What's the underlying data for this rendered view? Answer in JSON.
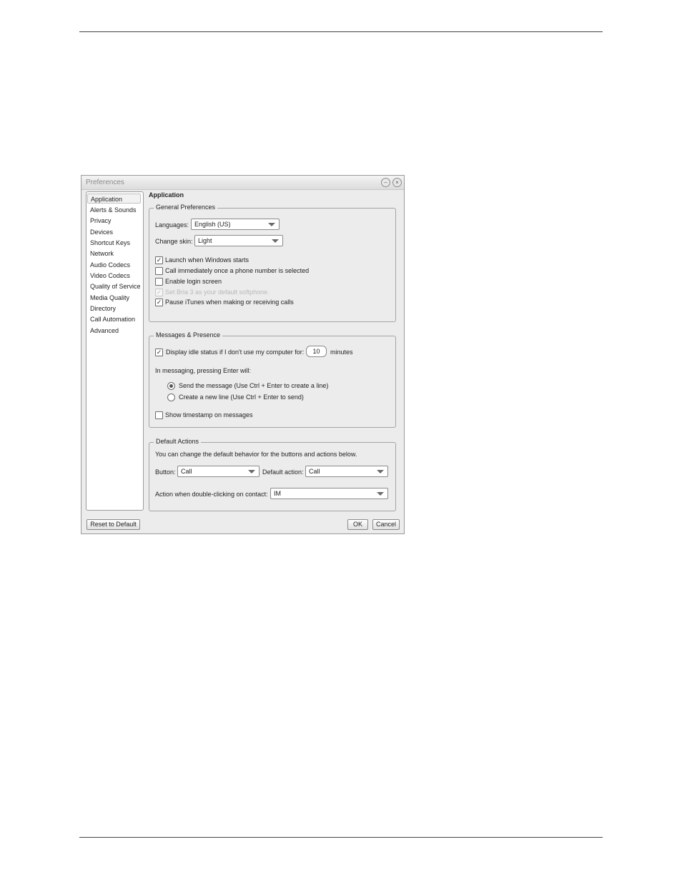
{
  "window": {
    "title": "Preferences",
    "minimize_icon": "–",
    "close_icon": "×"
  },
  "sidebar": {
    "items": [
      {
        "label": "Application",
        "selected": true
      },
      {
        "label": "Alerts & Sounds"
      },
      {
        "label": "Privacy"
      },
      {
        "label": "Devices"
      },
      {
        "label": "Shortcut Keys"
      },
      {
        "label": "Network"
      },
      {
        "label": "Audio Codecs"
      },
      {
        "label": "Video Codecs"
      },
      {
        "label": "Quality of Service"
      },
      {
        "label": "Media Quality"
      },
      {
        "label": "Directory"
      },
      {
        "label": "Call Automation"
      },
      {
        "label": "Advanced"
      }
    ]
  },
  "page_title": "Application",
  "general": {
    "title": "General Preferences",
    "languages_label": "Languages:",
    "languages_value": "English (US)",
    "skin_label": "Change skin:",
    "skin_value": "Light",
    "options": [
      {
        "label": "Launch when Windows starts",
        "checked": true,
        "disabled": false
      },
      {
        "label": "Call immediately once a phone number is selected",
        "checked": false,
        "disabled": false
      },
      {
        "label": "Enable login screen",
        "checked": false,
        "disabled": false
      },
      {
        "label": "Set Bria 3 as your default softphone.",
        "checked": true,
        "disabled": true
      },
      {
        "label": "Pause iTunes when making or receiving calls",
        "checked": true,
        "disabled": false
      }
    ]
  },
  "messages": {
    "title": "Messages & Presence",
    "idle_label": "Display idle status if I don't use my computer for:",
    "idle_checked": true,
    "idle_minutes": "10",
    "idle_unit": "minutes",
    "enter_label": "In messaging, pressing Enter will:",
    "radio_send": "Send the message (Use Ctrl + Enter to create a line)",
    "radio_newline": "Create a new line (Use Ctrl + Enter to send)",
    "selected_radio": "send",
    "timestamp_label": "Show timestamp on messages",
    "timestamp_checked": false
  },
  "default_actions": {
    "title": "Default Actions",
    "description": "You can change the default behavior for the buttons and actions below.",
    "button_label": "Button:",
    "button_value": "Call",
    "action_label": "Default action:",
    "action_value": "Call",
    "dblclick_label": "Action when double-clicking on contact:",
    "dblclick_value": "IM"
  },
  "buttons": {
    "reset": "Reset to Default",
    "ok": "OK",
    "cancel": "Cancel"
  },
  "icons": {
    "check": "✓"
  }
}
